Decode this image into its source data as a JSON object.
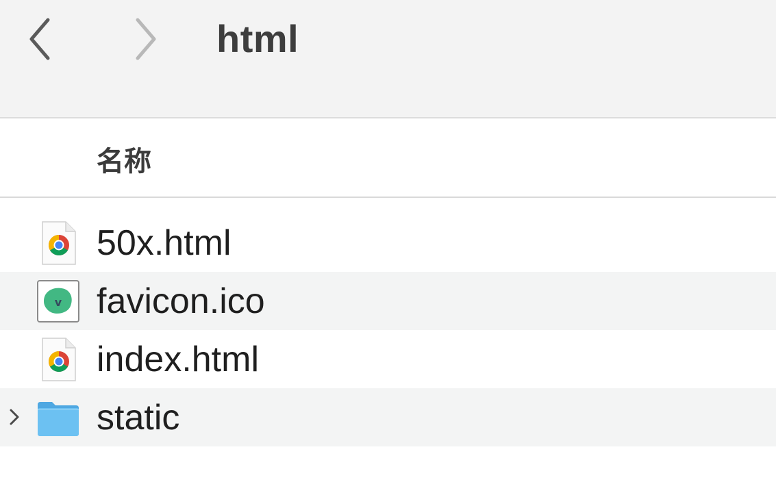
{
  "toolbar": {
    "back_icon": "chevron-left-icon",
    "forward_icon": "chevron-right-icon",
    "title": "html"
  },
  "columns": {
    "name": "名称"
  },
  "files": [
    {
      "name": "50x.html",
      "icon": "chrome-html-file-icon",
      "expandable": false
    },
    {
      "name": "favicon.ico",
      "icon": "vue-favicon-file-icon",
      "expandable": false
    },
    {
      "name": "index.html",
      "icon": "chrome-html-file-icon",
      "expandable": false
    },
    {
      "name": "static",
      "icon": "folder-icon",
      "expandable": true
    }
  ],
  "colors": {
    "toolbar_bg": "#f3f3f3",
    "alt_row_bg": "#f3f4f4",
    "folder_blue": "#5fb8ee",
    "vue_green": "#42b883"
  }
}
